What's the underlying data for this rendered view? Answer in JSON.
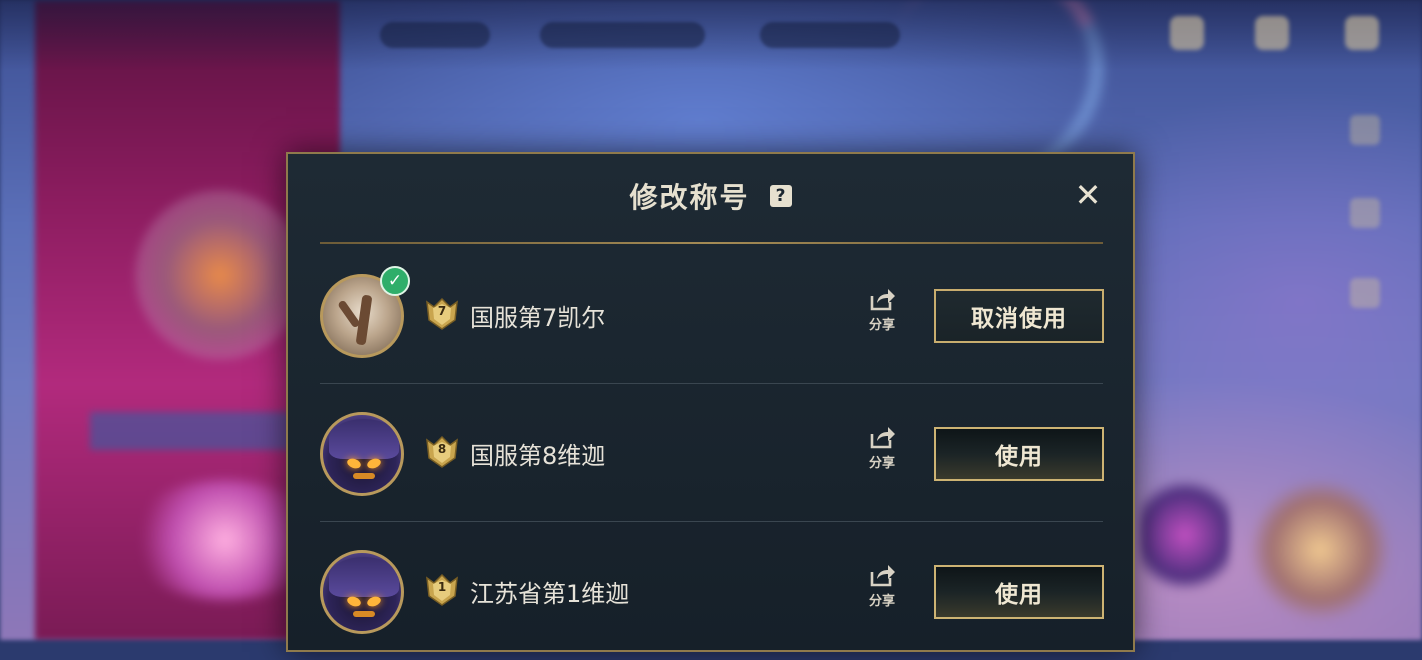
{
  "dialog": {
    "title": "修改称号",
    "help_glyph": "?",
    "close_glyph": "✕",
    "items": [
      {
        "avatar": "tree-skin-icon",
        "selected": true,
        "rank": "7",
        "title": "国服第7凯尔",
        "share_label": "分享",
        "button_label": "取消使用"
      },
      {
        "avatar": "veigar-icon",
        "selected": false,
        "rank": "8",
        "title": "国服第8维迦",
        "share_label": "分享",
        "button_label": "使用"
      },
      {
        "avatar": "veigar-icon",
        "selected": false,
        "rank": "1",
        "title": "江苏省第1维迦",
        "share_label": "分享",
        "button_label": "使用"
      }
    ]
  },
  "colors": {
    "accent_gold": "#c8ad6e",
    "selected_green": "#2fae6a",
    "panel_bg": "#1b2630"
  }
}
